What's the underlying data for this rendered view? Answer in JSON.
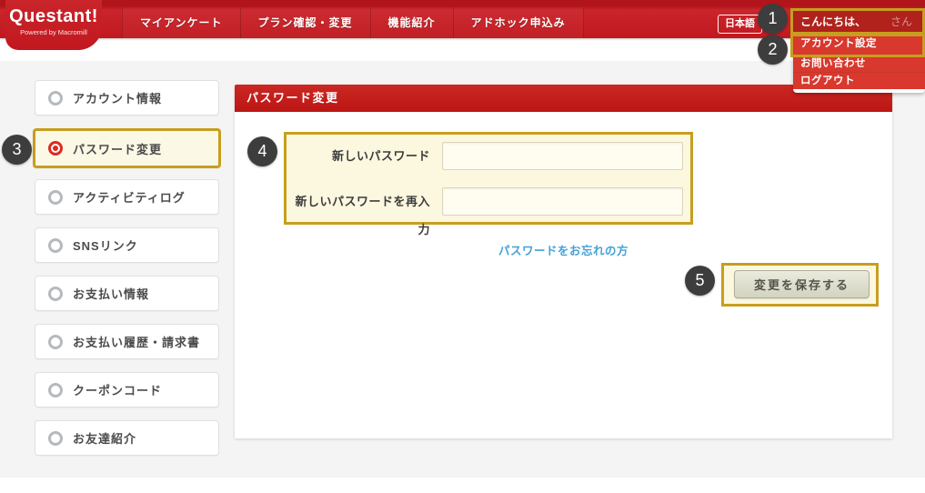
{
  "header": {
    "logo": {
      "brand": "Questant!",
      "tagline": "Powered by Macromill"
    },
    "nav": [
      {
        "key": "my-surveys",
        "label": "マイアンケート"
      },
      {
        "key": "plan",
        "label": "プラン確認・変更"
      },
      {
        "key": "features",
        "label": "機能紹介"
      },
      {
        "key": "adhoc",
        "label": "アドホック申込み"
      }
    ],
    "language_button": "日本語",
    "greeting": {
      "text": "こんにちは、",
      "name_suffix": "さん"
    }
  },
  "account_menu": {
    "items": [
      {
        "key": "account-settings",
        "label": "アカウント設定"
      },
      {
        "key": "contact",
        "label": "お問い合わせ"
      },
      {
        "key": "logout",
        "label": "ログアウト"
      }
    ]
  },
  "sidebar": {
    "items": [
      {
        "key": "account-info",
        "label": "アカウント情報",
        "active": false
      },
      {
        "key": "password-change",
        "label": "パスワード変更",
        "active": true
      },
      {
        "key": "activity-log",
        "label": "アクティビティログ",
        "active": false
      },
      {
        "key": "sns-link",
        "label": "SNSリンク",
        "active": false
      },
      {
        "key": "payment-info",
        "label": "お支払い情報",
        "active": false
      },
      {
        "key": "billing-history",
        "label": "お支払い履歴・請求書",
        "active": false
      },
      {
        "key": "coupon-code",
        "label": "クーポンコード",
        "active": false
      },
      {
        "key": "referral",
        "label": "お友達紹介",
        "active": false
      }
    ]
  },
  "main": {
    "panel_title": "パスワード変更",
    "form": {
      "fields": [
        {
          "label": "新しいパスワード",
          "value": ""
        },
        {
          "label": "新しいパスワードを再入力",
          "value": ""
        }
      ]
    },
    "forgot_link": "パスワードをお忘れの方",
    "save_button": "変更を保存する"
  },
  "annotations": {
    "badges": [
      "1",
      "2",
      "3",
      "4",
      "5"
    ],
    "highlight_color": "#c79e1f",
    "badge_color": "#3d3d3d"
  },
  "colors": {
    "brand_red": "#c2181f",
    "menu_red": "#d8382d",
    "greeting_red": "#b0221b",
    "link_blue": "#44a1d8",
    "page_gray": "#f4f4f4"
  }
}
